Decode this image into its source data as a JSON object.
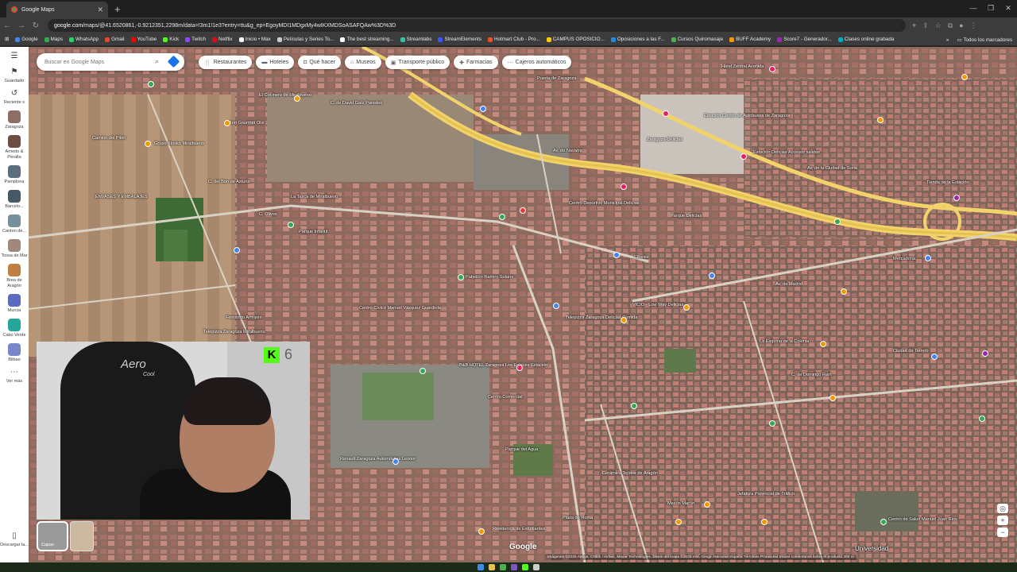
{
  "browser": {
    "tab_title": "Google Maps",
    "url_host": "google.com",
    "url_rest": "/maps/@41.6520861,-0.9212351,2298m/data=!3m1!1e3?entry=ttu&g_ep=EgoyMDI1MDgxMy4wIKXMDSoASAFQAw%3D%3D",
    "bookmarks": [
      {
        "label": "Google",
        "color": "#4285f4"
      },
      {
        "label": "Maps",
        "color": "#34a853"
      },
      {
        "label": "WhatsApp",
        "color": "#25d366"
      },
      {
        "label": "Gmail",
        "color": "#ea4335"
      },
      {
        "label": "YouTube",
        "color": "#ff0000"
      },
      {
        "label": "Kick",
        "color": "#53fc18"
      },
      {
        "label": "Twitch",
        "color": "#9146ff"
      },
      {
        "label": "Netflix",
        "color": "#e50914"
      },
      {
        "label": "Inicio • Max",
        "color": "#ffffff"
      },
      {
        "label": "Películas y Series To...",
        "color": "#cccccc"
      },
      {
        "label": "The best streaming...",
        "color": "#ffffff"
      },
      {
        "label": "Streamlabs",
        "color": "#31c3a2"
      },
      {
        "label": "StreamElements",
        "color": "#3a56ff"
      },
      {
        "label": "Hotmart Club - Pro...",
        "color": "#f04e23"
      },
      {
        "label": "CAMPUS OPOSICIO...",
        "color": "#ffcc00"
      },
      {
        "label": "Oposiciones a las F...",
        "color": "#1e88e5"
      },
      {
        "label": "Cursos Quiromasaje",
        "color": "#4caf50"
      },
      {
        "label": "BUFF Academy",
        "color": "#ff9800"
      },
      {
        "label": "Score7 - Generador...",
        "color": "#9c27b0"
      },
      {
        "label": "Clases online grabada",
        "color": "#00acc1"
      }
    ],
    "all_bookmarks": "Todos los marcadores"
  },
  "sidebar": {
    "menu_icon": "hamburger-icon",
    "items": [
      {
        "label": "Guardado",
        "icon": "bookmark-icon"
      },
      {
        "label": "Reciente s",
        "icon": "history-icon"
      },
      {
        "label": "Zaragoza",
        "color": "#8d6e63"
      },
      {
        "label": "Arnedo & Peralta",
        "color": "#6d4c41"
      },
      {
        "label": "Pamplona",
        "color": "#5d6d7e"
      },
      {
        "label": "Barcelo...",
        "color": "#455a64"
      },
      {
        "label": "Canton de...",
        "color": "#78909c"
      },
      {
        "label": "Tossa de Mar",
        "color": "#a1887f"
      },
      {
        "label": "Brea de Aragón",
        "color": "#bf8040"
      },
      {
        "label": "Murcia",
        "color": "#5c6bc0"
      },
      {
        "label": "Cabo Verde",
        "color": "#26a69a"
      },
      {
        "label": "Bilbao",
        "color": "#7986cb"
      },
      {
        "label": "Ver más",
        "icon": "more-icon"
      }
    ],
    "download_label": "Descargar la..."
  },
  "search": {
    "placeholder": "Buscar en Google Maps"
  },
  "chips": [
    {
      "label": "Restaurantes",
      "icon": "fork-knife-icon"
    },
    {
      "label": "Hoteles",
      "icon": "bed-icon"
    },
    {
      "label": "Qué hacer",
      "icon": "camera-icon"
    },
    {
      "label": "Museos",
      "icon": "museum-icon"
    },
    {
      "label": "Transporte público",
      "icon": "train-icon"
    },
    {
      "label": "Farmacias",
      "icon": "pharmacy-icon"
    },
    {
      "label": "Cajeros automáticos",
      "icon": "atm-icon"
    }
  ],
  "webcam": {
    "chair_brand": "Aero",
    "chair_brand_sub": "Cool",
    "kick_logo": "K",
    "viewer_count": "6"
  },
  "map_labels": [
    {
      "text": "Puerta de Zaragoza",
      "color": "#ffffff"
    },
    {
      "text": "Hotel Zentral Avenida",
      "color": "#ffffff"
    },
    {
      "text": "Estación Centro de Autobuses de Zaragoza",
      "color": "#ffffff"
    },
    {
      "text": "Zaragoza-Delicias",
      "color": "#ffffff"
    },
    {
      "text": "Estación Delicias Accesos salidas",
      "color": "#ffffff"
    },
    {
      "text": "Av. de la Ciudad de Soria",
      "color": "#ffffff"
    },
    {
      "text": "Av. de Navarra",
      "color": "#ffffff"
    },
    {
      "text": "El Cocinero de Miralbueno",
      "color": "#ffffff"
    },
    {
      "text": "C. de David Gaíz Paredes",
      "color": "#ffffff"
    },
    {
      "text": "Bon Gourmet Olsi",
      "color": "#ffffff"
    },
    {
      "text": "Camino del Pilón",
      "color": "#ffffff"
    },
    {
      "text": "Grupo Kiosko Miralbueno",
      "color": "#ffffff"
    },
    {
      "text": "ENVASES Y EMBALAJES",
      "color": "#ffffff"
    },
    {
      "text": "C. del Bon de Asturia",
      "color": "#ffffff"
    },
    {
      "text": "La Tasca de Miralbueno",
      "color": "#ffffff"
    },
    {
      "text": "C. Olivos",
      "color": "#ffffff"
    },
    {
      "text": "Parque Infantil",
      "color": "#ffffff"
    },
    {
      "text": "Pabellón Ramiro Solans",
      "color": "#ffffff"
    },
    {
      "text": "Centro Cívico Manuel Vázquez Guardiola",
      "color": "#ffffff"
    },
    {
      "text": "Fernando Armisén",
      "color": "#ffffff"
    },
    {
      "text": "Telepizza Zaragoza Miralbueno",
      "color": "#ffffff"
    },
    {
      "text": "Centro Deportivo Municipal Delicias",
      "color": "#ffffff"
    },
    {
      "text": "Parque Delicias",
      "color": "#ffffff"
    },
    {
      "text": "Telepizza Zaragoza Delicias Comida",
      "color": "#ffffff"
    },
    {
      "text": "B&B HOTEL Zaragoza Los Enlaces Estación",
      "color": "#ffffff"
    },
    {
      "text": "Cibeles",
      "color": "#ffffff"
    },
    {
      "text": "VICIO - Low Way Delicias",
      "color": "#ffffff"
    },
    {
      "text": "Av. de Madrid",
      "color": "#ffffff"
    },
    {
      "text": "Tienda de la Estación",
      "color": "#ffffff"
    },
    {
      "text": "Mercadona",
      "color": "#ffffff"
    },
    {
      "text": "La Esquina de la Colonia",
      "color": "#ffffff"
    },
    {
      "text": "C. de Domingo Ram",
      "color": "#ffffff"
    },
    {
      "text": "Ciudad de Terrero",
      "color": "#ffffff"
    },
    {
      "text": "Centro Comercial",
      "color": "#ffffff"
    },
    {
      "text": "Renault Zaragoza Automóviles Leonor",
      "color": "#ffffff"
    },
    {
      "text": "Parque del Agua",
      "color": "#ffffff"
    },
    {
      "text": "Plaza de Roma",
      "color": "#ffffff"
    },
    {
      "text": "Mesón Martín",
      "color": "#ffffff"
    },
    {
      "text": "Jefatura Provincial de Tráfico",
      "color": "#ffffff"
    },
    {
      "text": "Residencia de Estudiantes",
      "color": "#ffffff"
    },
    {
      "text": "Cerámica Tejidos de Aragón",
      "color": "#ffffff"
    },
    {
      "text": "Centro de Salud Manuel Juan Rios",
      "color": "#ffffff"
    },
    {
      "text": "Universidad",
      "color": "#ffffff"
    }
  ],
  "map_footer": {
    "google": "Google",
    "attribution": "Imágenes ©2025 Airbus, CNES / Airbus, Maxar Technologies, Datos del mapa ©2025 Inst. Geogr. Nacional   España   Términos   Privacidad   Enviar comentarios sobre el producto   200 m"
  },
  "layers_label": "Capas",
  "zoom": {
    "in": "+",
    "out": "−"
  }
}
